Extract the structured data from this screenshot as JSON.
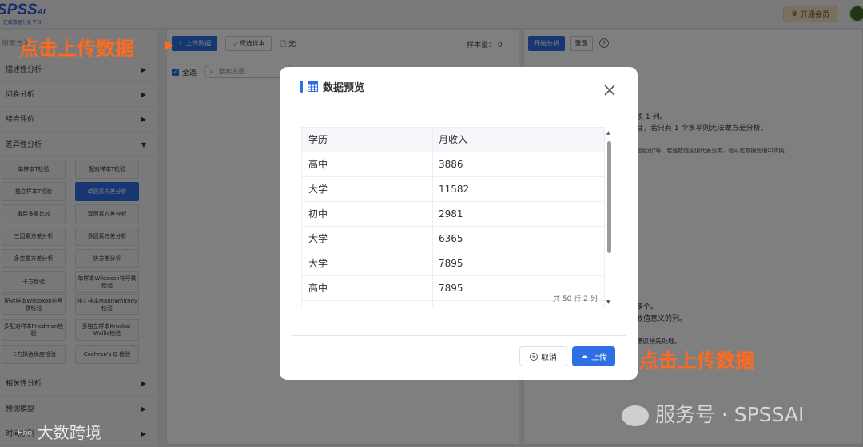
{
  "app": {
    "logo": "SPSS",
    "logo_suffix": "AI",
    "logo_subtitle": "在线数据分析平台",
    "vip_label": "开通会员"
  },
  "sidebar": {
    "search_placeholder": "搜索方法",
    "categories": [
      {
        "label": "描述性分析"
      },
      {
        "label": "问卷分析"
      },
      {
        "label": "综合评价"
      },
      {
        "label": "差异性分析"
      },
      {
        "label": "相关性分析"
      },
      {
        "label": "预测模型"
      },
      {
        "label": "时间序列"
      }
    ],
    "tests": [
      "单样本T检验",
      "配对样本T检验",
      "独立样本T检验",
      "单因素方差分析",
      "事后多重比较",
      "双因素方差分析",
      "三因素方差分析",
      "多因素方差分析",
      "多变量方差分析",
      "协方差分析",
      "卡方检验",
      "单样本Wilcoxon符号秩检验",
      "配对样本Wilcoxon符号秩检验",
      "独立样本MannWhitney检验",
      "多配对样本Friedman检验",
      "多独立样本Kruskal-Wallis检验",
      "卡方拟合优度检验",
      "Cochran's Q 检验"
    ],
    "active_test_index": 3
  },
  "toolbar": {
    "upload_label": "上传数据",
    "filter_label": "筛选样本",
    "file_label": "无",
    "sample_count_label": "样本量：",
    "sample_count": "0",
    "start_label": "开始分析",
    "reset_label": "重置"
  },
  "variables": {
    "select_all_label": "全选",
    "search_placeholder": "搜索变量..."
  },
  "right_panel": {
    "lines": [
      "须 1 列。",
      "且，若只有 1 个水平则无法做方差分析。",
      "验组别\"等，若是数值型但代表分类，也可在数据处理中转换。",
      "多个。",
      "数值意义的列。",
      "建议预先处理。"
    ]
  },
  "annotations": {
    "top": "点击上传数据",
    "bottom": "点击上传数据"
  },
  "modal": {
    "title": "数据预览",
    "columns": [
      "学历",
      "月收入"
    ],
    "rows": [
      [
        "高中",
        "3886"
      ],
      [
        "大学",
        "11582"
      ],
      [
        "初中",
        "2981"
      ],
      [
        "大学",
        "6365"
      ],
      [
        "大学",
        "7895"
      ],
      [
        "高中",
        "7895"
      ]
    ],
    "pager": "共 50 行 2 列",
    "cancel_label": "取消",
    "upload_label": "上传"
  },
  "watermarks": {
    "left": "大数跨境",
    "right": "服务号 · SPSSAI"
  },
  "colors": {
    "primary": "#2f6fe4",
    "annotation": "#ff6a1f",
    "vip_bg": "#f3e1c4"
  }
}
